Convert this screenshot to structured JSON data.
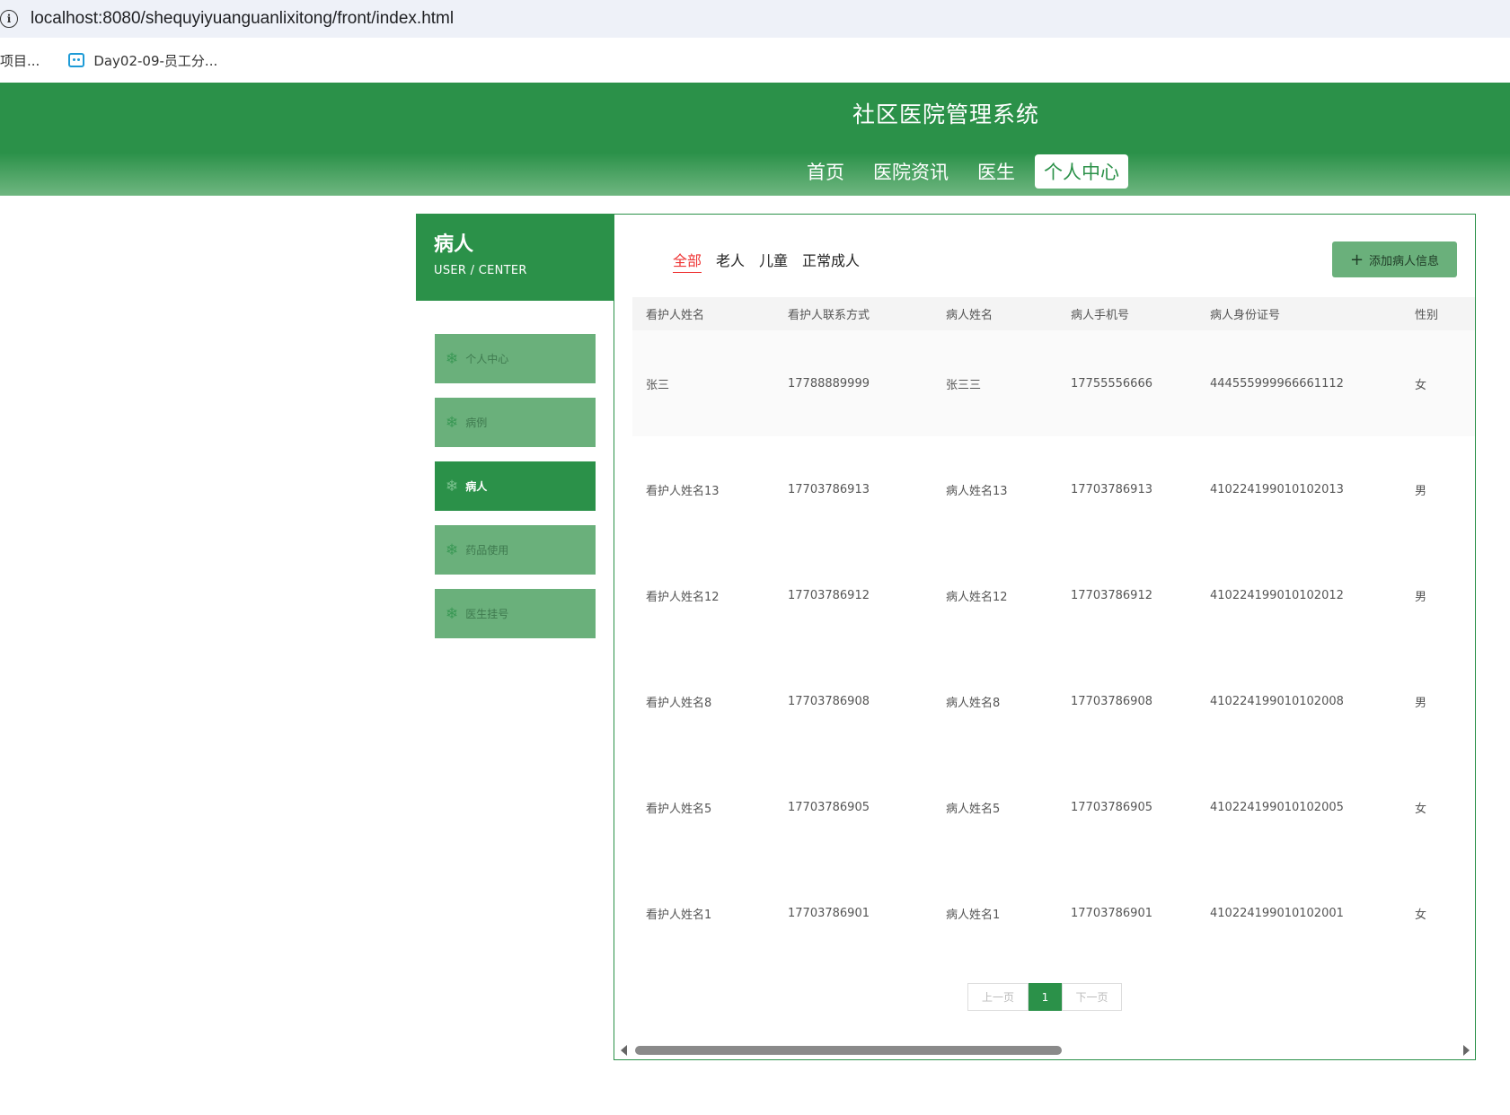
{
  "browser": {
    "url": "localhost:8080/shequyiyuanguanlixitong/front/index.html",
    "bookmarks": [
      {
        "label": "项目..."
      },
      {
        "label": "Day02-09-员工分..."
      }
    ]
  },
  "header": {
    "title": "社区医院管理系统",
    "nav": [
      {
        "label": "首页"
      },
      {
        "label": "医院资讯"
      },
      {
        "label": "医生"
      },
      {
        "label": "个人中心"
      }
    ]
  },
  "sidebar": {
    "title": "病人",
    "subtitle": "USER / CENTER",
    "items": [
      {
        "label": "个人中心"
      },
      {
        "label": "病例"
      },
      {
        "label": "病人"
      },
      {
        "label": "药品使用"
      },
      {
        "label": "医生挂号"
      }
    ]
  },
  "main": {
    "filters": [
      "全部",
      "老人",
      "儿童",
      "正常成人"
    ],
    "add_button": "添加病人信息",
    "columns": [
      "看护人姓名",
      "看护人联系方式",
      "病人姓名",
      "病人手机号",
      "病人身份证号",
      "性别"
    ],
    "rows": [
      [
        "张三",
        "17788889999",
        "张三三",
        "17755556666",
        "444555999966661112",
        "女"
      ],
      [
        "看护人姓名13",
        "17703786913",
        "病人姓名13",
        "17703786913",
        "410224199010102013",
        "男"
      ],
      [
        "看护人姓名12",
        "17703786912",
        "病人姓名12",
        "17703786912",
        "410224199010102012",
        "男"
      ],
      [
        "看护人姓名8",
        "17703786908",
        "病人姓名8",
        "17703786908",
        "410224199010102008",
        "男"
      ],
      [
        "看护人姓名5",
        "17703786905",
        "病人姓名5",
        "17703786905",
        "410224199010102005",
        "女"
      ],
      [
        "看护人姓名1",
        "17703786901",
        "病人姓名1",
        "17703786901",
        "410224199010102001",
        "女"
      ]
    ],
    "pagination": {
      "prev": "上一页",
      "current": "1",
      "next": "下一页"
    }
  },
  "colors": {
    "primary": "#2b9149",
    "menu_bg": "#6ab07b",
    "filter_active": "#e33333"
  }
}
